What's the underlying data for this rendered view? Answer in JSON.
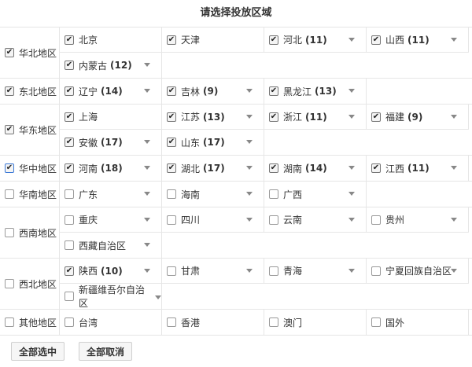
{
  "title": "请选择投放区域",
  "icons": {
    "checkbox": "checkbox-icon",
    "dropdown": "chevron-down-icon"
  },
  "regions": [
    {
      "name": "华北地区",
      "checked": true,
      "provinces": [
        {
          "name": "北京",
          "checked": true,
          "count": "",
          "dropdown": false
        },
        {
          "name": "天津",
          "checked": true,
          "count": "",
          "dropdown": false
        },
        {
          "name": "河北",
          "checked": true,
          "count": "(11)",
          "dropdown": true
        },
        {
          "name": "山西",
          "checked": true,
          "count": "(11)",
          "dropdown": true
        },
        {
          "name": "内蒙古",
          "checked": true,
          "count": "(12)",
          "dropdown": true
        }
      ]
    },
    {
      "name": "东北地区",
      "checked": true,
      "provinces": [
        {
          "name": "辽宁",
          "checked": true,
          "count": "(14)",
          "dropdown": true
        },
        {
          "name": "吉林",
          "checked": true,
          "count": "(9)",
          "dropdown": true
        },
        {
          "name": "黑龙江",
          "checked": true,
          "count": "(13)",
          "dropdown": true
        }
      ]
    },
    {
      "name": "华东地区",
      "checked": true,
      "provinces": [
        {
          "name": "上海",
          "checked": true,
          "count": "",
          "dropdown": false
        },
        {
          "name": "江苏",
          "checked": true,
          "count": "(13)",
          "dropdown": true
        },
        {
          "name": "浙江",
          "checked": true,
          "count": "(11)",
          "dropdown": true
        },
        {
          "name": "福建",
          "checked": true,
          "count": "(9)",
          "dropdown": true
        },
        {
          "name": "安徽",
          "checked": true,
          "count": "(17)",
          "dropdown": true
        },
        {
          "name": "山东",
          "checked": true,
          "count": "(17)",
          "dropdown": true
        }
      ]
    },
    {
      "name": "华中地区",
      "checked": true,
      "focused": true,
      "provinces": [
        {
          "name": "河南",
          "checked": true,
          "count": "(18)",
          "dropdown": true
        },
        {
          "name": "湖北",
          "checked": true,
          "count": "(17)",
          "dropdown": true
        },
        {
          "name": "湖南",
          "checked": true,
          "count": "(14)",
          "dropdown": true
        },
        {
          "name": "江西",
          "checked": true,
          "count": "(11)",
          "dropdown": true
        }
      ]
    },
    {
      "name": "华南地区",
      "checked": false,
      "provinces": [
        {
          "name": "广东",
          "checked": false,
          "count": "",
          "dropdown": true
        },
        {
          "name": "海南",
          "checked": false,
          "count": "",
          "dropdown": true
        },
        {
          "name": "广西",
          "checked": false,
          "count": "",
          "dropdown": true
        }
      ]
    },
    {
      "name": "西南地区",
      "checked": false,
      "provinces": [
        {
          "name": "重庆",
          "checked": false,
          "count": "",
          "dropdown": true
        },
        {
          "name": "四川",
          "checked": false,
          "count": "",
          "dropdown": true
        },
        {
          "name": "云南",
          "checked": false,
          "count": "",
          "dropdown": true
        },
        {
          "name": "贵州",
          "checked": false,
          "count": "",
          "dropdown": true
        },
        {
          "name": "西藏自治区",
          "checked": false,
          "count": "",
          "dropdown": true
        }
      ]
    },
    {
      "name": "西北地区",
      "checked": false,
      "provinces": [
        {
          "name": "陕西",
          "checked": true,
          "count": "(10)",
          "dropdown": true
        },
        {
          "name": "甘肃",
          "checked": false,
          "count": "",
          "dropdown": true
        },
        {
          "name": "青海",
          "checked": false,
          "count": "",
          "dropdown": true
        },
        {
          "name": "宁夏回族自治区",
          "checked": false,
          "count": "",
          "dropdown": true
        },
        {
          "name": "新疆维吾尔自治区",
          "checked": false,
          "count": "",
          "dropdown": true,
          "inline_caret": true
        }
      ]
    },
    {
      "name": "其他地区",
      "checked": false,
      "provinces": [
        {
          "name": "台湾",
          "checked": false,
          "count": "",
          "dropdown": false
        },
        {
          "name": "香港",
          "checked": false,
          "count": "",
          "dropdown": false
        },
        {
          "name": "澳门",
          "checked": false,
          "count": "",
          "dropdown": false
        },
        {
          "name": "国外",
          "checked": false,
          "count": "",
          "dropdown": false
        }
      ]
    }
  ],
  "buttons": {
    "select_all": "全部选中",
    "cancel_all": "全部取消"
  }
}
